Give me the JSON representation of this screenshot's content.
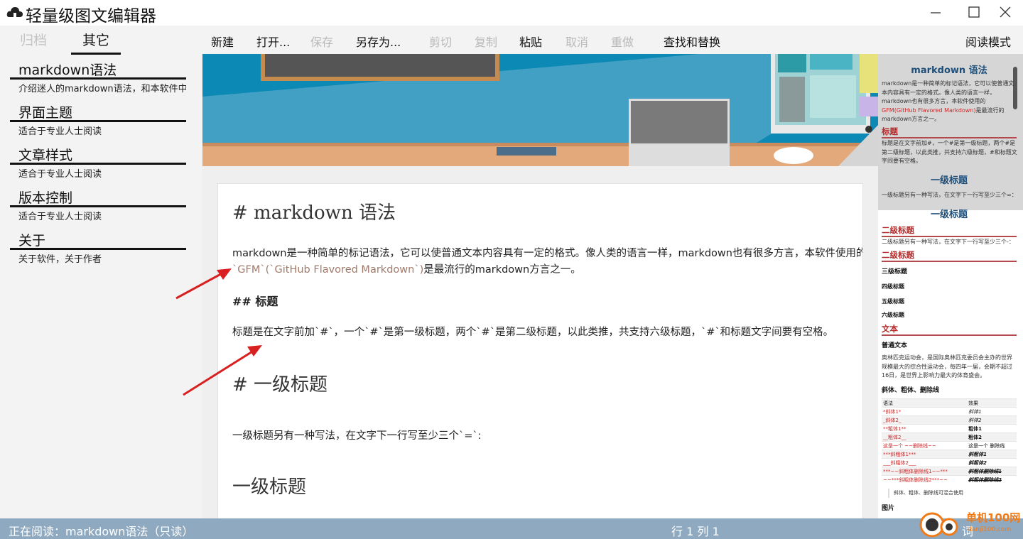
{
  "window": {
    "title": "轻量级图文编辑器"
  },
  "sidebar": {
    "tabs": [
      {
        "label": "归档"
      },
      {
        "label": "其它"
      }
    ],
    "items": [
      {
        "title": "markdown语法",
        "desc": "介绍迷人的markdown语法，和本软件中"
      },
      {
        "title": "界面主题",
        "desc": "适合于专业人士阅读"
      },
      {
        "title": "文章样式",
        "desc": "适合于专业人士阅读"
      },
      {
        "title": "版本控制",
        "desc": "适合于专业人士阅读"
      },
      {
        "title": "关于",
        "desc": "关于软件，关于作者"
      }
    ]
  },
  "toolbar": {
    "new": "新建",
    "open": "打开...",
    "save": "保存",
    "save_as": "另存为...",
    "cut": "剪切",
    "copy": "复制",
    "paste": "粘贴",
    "undo": "取消",
    "redo": "重做",
    "find_replace": "查找和替换",
    "reading_mode": "阅读模式"
  },
  "editor": {
    "h1": "# markdown 语法",
    "p1_line1": "markdown是一种简单的标记语法，它可以使普通文本内容具有一定的格式。像人类的语言一样，markdown也有很多方言，本软件使用的",
    "p1_code": "`GFM`(`GitHub Flavored Markdown`)",
    "p1_line2_rest": "是最流行的markdown方言之一。",
    "h2": "## 标题",
    "p2": "标题是在文字前加`#`，一个`#`是第一级标题，两个`#`是第二级标题，以此类推，共支持六级标题，`#`和标题文字间要有空格。",
    "h1b": "# 一级标题",
    "p3": "一级标题另有一种写法，在文字下一行写至少三个`=`:",
    "h1c": "一级标题"
  },
  "preview": {
    "title": "markdown 语法",
    "intro_1": "markdown是一种简单的标记语法，它可以使普通文",
    "intro_2": "本内容具有一定的格式。像人类的语言一样，",
    "intro_3": "markdown也有很多方言，本软件使用的",
    "intro_4_red": "GFM(GitHub Flavored Markdown)",
    "intro_4_rest": "是最流行的",
    "intro_5": "markdown方言之一。",
    "h_title": "标题",
    "title_desc_1": "标题是在文字前加#，一个#是第一级标题，两个#是",
    "title_desc_2": "第二级标题，以此类推，共支持六级标题，#和标题文",
    "title_desc_3": "字间要有空格。",
    "h1_sample": "一级标题",
    "h1_alt_desc": "一级标题另有一种写法，在文字下一行写至少三个=：",
    "h1_sample_2": "一级标题",
    "h2_sample": "二级标题",
    "h2_alt_desc": "二级标题另有一种写法，在文字下一行写至少三个-：",
    "h2_sample_2": "二级标题",
    "h3": "三级标题",
    "h4": "四级标题",
    "h5": "五级标题",
    "h6": "六级标题",
    "h_text": "文本",
    "plain_text": "普通文本",
    "plain_desc_1": "奥林匹克运动会，是国际奥林匹克委员会主办的世界",
    "plain_desc_2": "规模最大的综合性运动会，每四年一届，会期不超过",
    "plain_desc_3": "16日，是世界上影响力最大的体育盛会。",
    "styles_title": "斜体、粗体、删除线",
    "table_head": [
      "语法",
      "效果"
    ],
    "table_rows": [
      [
        "*斜体1*",
        "斜体1"
      ],
      [
        "_斜体2_",
        "斜体2"
      ],
      [
        "**粗体1**",
        "粗体1"
      ],
      [
        "__粗体2__",
        "粗体2"
      ],
      [
        "这是一个 ~~删除线~~",
        "这是一个 删除线"
      ],
      [
        "***斜粗体1***",
        "斜粗体1"
      ],
      [
        "___斜粗体2___",
        "斜粗体2"
      ],
      [
        "***~~斜粗体删除线1~~***",
        "斜粗体删除线1"
      ],
      [
        "~~***斜粗体删除线2***~~",
        "斜粗体删除线2"
      ]
    ],
    "table_note": "斜体、粗体、删除线可混合使用",
    "image_title": "图片"
  },
  "status": {
    "reading": "正在阅读：markdown语法（只读）",
    "position": "行 1 列 1",
    "right": "词"
  },
  "watermark": {
    "text": "单机100网",
    "sub": "danji100.com"
  },
  "colors": {
    "statusbar": "#8ea9c0",
    "heading_red": "#b22a2a",
    "preview_h1": "#1f4f78",
    "arrow": "#d92020"
  }
}
